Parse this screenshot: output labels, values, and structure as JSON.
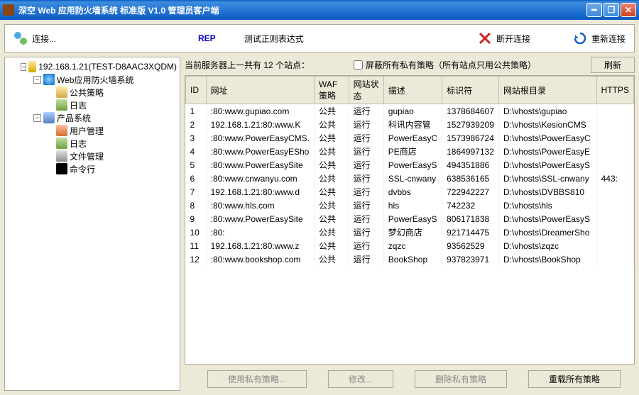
{
  "title": "深空 Web 应用防火墙系统 标准版 V1.0 管理员客户端",
  "toolbar": {
    "connect": "连接...",
    "rep": "REP",
    "test_regex": "测试正则表达式",
    "disconnect": "断开连接",
    "reconnect": "重新连接"
  },
  "tree": {
    "root": "192.168.1.21(TEST-D8AAC3XQDM)",
    "waf_sys": "Web应用防火墙系统",
    "public_policy": "公共策略",
    "log1": "日志",
    "prod_sys": "产品系统",
    "user_mgmt": "用户管理",
    "log2": "日志",
    "file_mgmt": "文件管理",
    "cmdline": "命令行"
  },
  "summary": {
    "label_pre": "当前服务器上一共有 ",
    "count": "12",
    "label_post": " 个站点：",
    "checkbox_label": "屏蔽所有私有策略（所有站点只用公共策略）",
    "refresh": "刷新"
  },
  "columns": {
    "id": "ID",
    "url": "网址",
    "waf": "WAF策略",
    "status": "网站状态",
    "desc": "描述",
    "ident": "标识符",
    "root": "网站根目录",
    "https": "HTTPS"
  },
  "rows": [
    {
      "id": "1",
      "url": ":80:www.gupiao.com",
      "waf": "公共",
      "status": "运行",
      "desc": "gupiao",
      "ident": "1378684607",
      "root": "D:\\vhosts\\gupiao",
      "https": ""
    },
    {
      "id": "2",
      "url": "192.168.1.21:80:www.K",
      "waf": "公共",
      "status": "运行",
      "desc": "科讯内容管",
      "ident": "1527939209",
      "root": "D:\\vhosts\\KesionCMS",
      "https": ""
    },
    {
      "id": "3",
      "url": ":80:www.PowerEasyCMS.",
      "waf": "公共",
      "status": "运行",
      "desc": "PowerEasyC",
      "ident": "1573986724",
      "root": "D:\\vhosts\\PowerEasyC",
      "https": ""
    },
    {
      "id": "4",
      "url": ":80:www.PowerEasyESho",
      "waf": "公共",
      "status": "运行",
      "desc": "PE商店",
      "ident": "1864997132",
      "root": "D:\\vhosts\\PowerEasyE",
      "https": ""
    },
    {
      "id": "5",
      "url": ":80:www.PowerEasySite",
      "waf": "公共",
      "status": "运行",
      "desc": "PowerEasyS",
      "ident": "494351886",
      "root": "D:\\vhosts\\PowerEasyS",
      "https": ""
    },
    {
      "id": "6",
      "url": ":80:www.cnwanyu.com",
      "waf": "公共",
      "status": "运行",
      "desc": "SSL-cnwany",
      "ident": "638536165",
      "root": "D:\\vhosts\\SSL-cnwany",
      "https": "443:"
    },
    {
      "id": "7",
      "url": "192.168.1.21:80:www.d",
      "waf": "公共",
      "status": "运行",
      "desc": "dvbbs",
      "ident": "722942227",
      "root": "D:\\vhosts\\DVBBS810",
      "https": ""
    },
    {
      "id": "8",
      "url": ":80:www.hls.com",
      "waf": "公共",
      "status": "运行",
      "desc": "hls",
      "ident": "742232",
      "root": "D:\\vhosts\\hls",
      "https": ""
    },
    {
      "id": "9",
      "url": ":80:www.PowerEasySite",
      "waf": "公共",
      "status": "运行",
      "desc": "PowerEasyS",
      "ident": "806171838",
      "root": "D:\\vhosts\\PowerEasyS",
      "https": ""
    },
    {
      "id": "10",
      "url": ":80:",
      "waf": "公共",
      "status": "运行",
      "desc": "梦幻商店",
      "ident": "921714475",
      "root": "D:\\vhosts\\DreamerSho",
      "https": ""
    },
    {
      "id": "11",
      "url": "192.168.1.21:80:www.z",
      "waf": "公共",
      "status": "运行",
      "desc": "zqzc",
      "ident": "93562529",
      "root": "D:\\vhosts\\zqzc",
      "https": ""
    },
    {
      "id": "12",
      "url": ":80:www.bookshop.com",
      "waf": "公共",
      "status": "运行",
      "desc": "BookShop",
      "ident": "937823971",
      "root": "D:\\vhosts\\BookShop",
      "https": ""
    }
  ],
  "buttons": {
    "use_private": "使用私有策略...",
    "modify": "修改...",
    "del_private": "删除私有策略",
    "reload_all": "重载所有策略"
  }
}
